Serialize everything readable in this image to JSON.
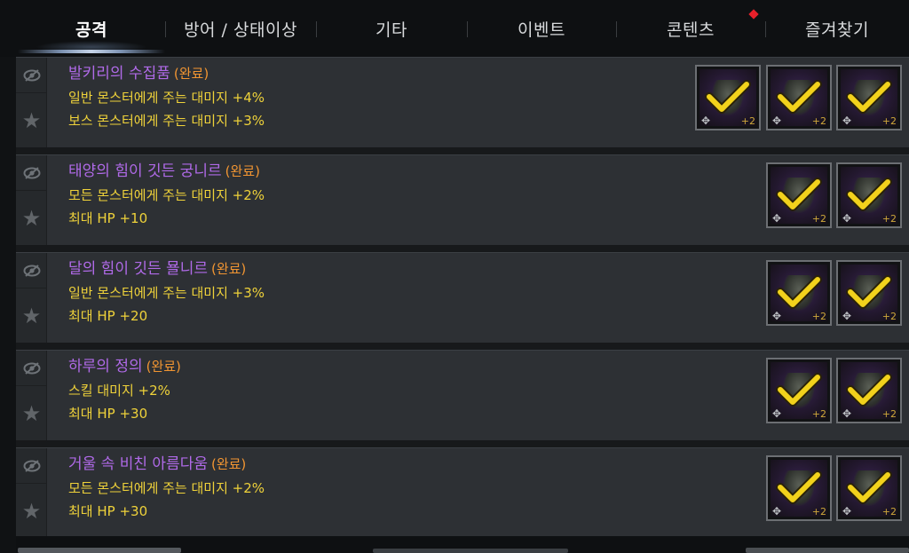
{
  "tabs": [
    {
      "label": "공격",
      "active": true
    },
    {
      "label": "방어 / 상태이상",
      "active": false
    },
    {
      "label": "기타",
      "active": false
    },
    {
      "label": "이벤트",
      "active": false
    },
    {
      "label": "콘텐츠",
      "active": false,
      "notification": true
    },
    {
      "label": "즐겨찾기",
      "active": false
    }
  ],
  "colors": {
    "title": "#b06ae8",
    "status": "#f19532",
    "effect": "#efd23a",
    "check": "#f2d21c",
    "notification": "#e8202a"
  },
  "icons": {
    "visibility": "eye-icon",
    "favorite": "star-icon",
    "check": "checkmark-icon",
    "move": "move-arrows-icon"
  },
  "collections": [
    {
      "title": "발키리의 수집품",
      "status": "(완료)",
      "effects": [
        "일반 몬스터에게 주는 대미지 +4%",
        "보스 몬스터에게 주는 대미지 +3%"
      ],
      "items": [
        {
          "enhance": "+2"
        },
        {
          "enhance": "+2"
        },
        {
          "enhance": "+2"
        }
      ]
    },
    {
      "title": "태양의 힘이 깃든 궁니르",
      "status": "(완료)",
      "effects": [
        "모든 몬스터에게 주는 대미지 +2%",
        "최대 HP +10"
      ],
      "items": [
        {
          "enhance": "+2"
        },
        {
          "enhance": "+2"
        }
      ]
    },
    {
      "title": "달의 힘이 깃든 묠니르",
      "status": "(완료)",
      "effects": [
        "일반 몬스터에게 주는 대미지 +3%",
        "최대 HP +20"
      ],
      "items": [
        {
          "enhance": "+2"
        },
        {
          "enhance": "+2"
        }
      ]
    },
    {
      "title": "하루의 정의",
      "status": "(완료)",
      "effects": [
        "스킬 대미지 +2%",
        "최대 HP +30"
      ],
      "items": [
        {
          "enhance": "+2"
        },
        {
          "enhance": "+2"
        }
      ]
    },
    {
      "title": "거울 속 비친 아름다움",
      "status": "(완료)",
      "effects": [
        "모든 몬스터에게 주는 대미지 +2%",
        "최대 HP +30"
      ],
      "items": [
        {
          "enhance": "+2"
        },
        {
          "enhance": "+2"
        }
      ]
    }
  ]
}
